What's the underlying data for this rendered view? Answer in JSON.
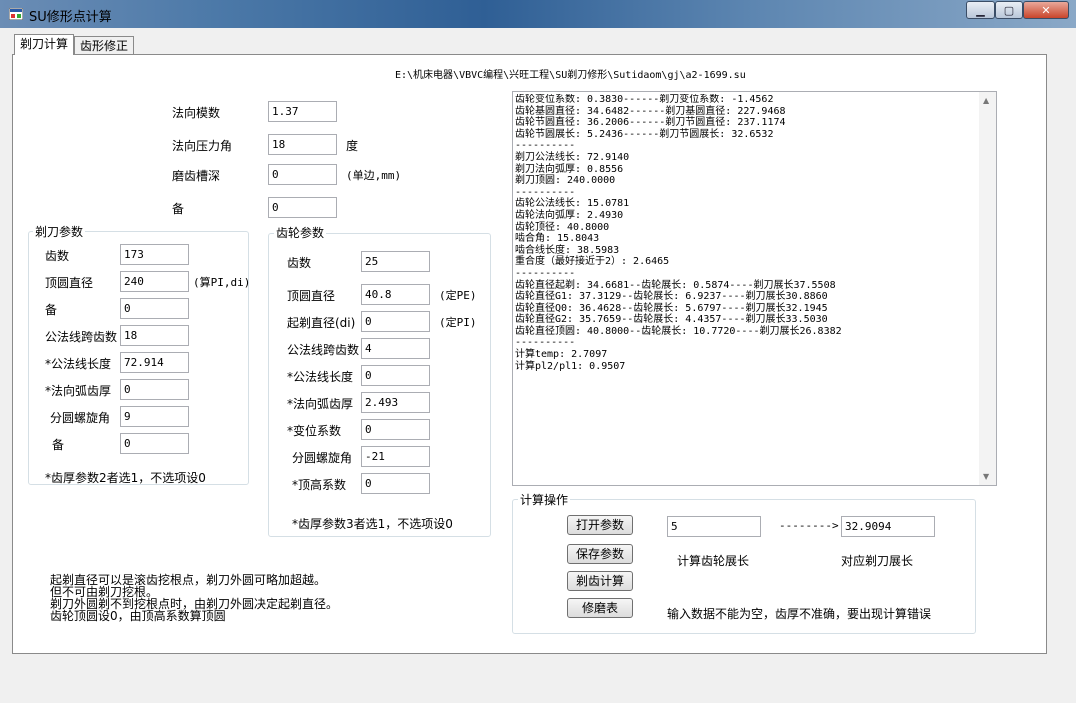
{
  "window": {
    "title": "SU修形点计算"
  },
  "tabs": [
    {
      "label": "剃刀计算"
    },
    {
      "label": "齿形修正"
    }
  ],
  "file_path": "E:\\机床电器\\VBVC编程\\兴旺工程\\SU剃刀修形\\Sutidaom\\gj\\a2-1699.su",
  "top_fields": [
    {
      "label": "法向模数",
      "value": "1.37",
      "unit": ""
    },
    {
      "label": "法向压力角",
      "value": "18",
      "unit": "度"
    },
    {
      "label": "磨齿槽深",
      "value": "0",
      "unit": "(单边,mm)"
    },
    {
      "label": "备",
      "value": "0",
      "unit": ""
    }
  ],
  "shaver_group": {
    "title": "剃刀参数",
    "fields": [
      {
        "label": "齿数",
        "value": "173",
        "unit": ""
      },
      {
        "label": "顶圆直径",
        "value": "240",
        "unit": "(算PI,di)"
      },
      {
        "label": "备",
        "value": "0",
        "unit": ""
      },
      {
        "label": "公法线跨齿数",
        "value": "18",
        "unit": ""
      },
      {
        "label": "*公法线长度",
        "value": "72.914",
        "unit": ""
      },
      {
        "label": "*法向弧齿厚",
        "value": "0",
        "unit": ""
      },
      {
        "label": "分圆螺旋角",
        "value": "9",
        "unit": ""
      },
      {
        "label": "备",
        "value": "0",
        "unit": ""
      }
    ],
    "note": "*齿厚参数2者选1，不选项设0"
  },
  "gear_group": {
    "title": "齿轮参数",
    "fields": [
      {
        "label": "齿数",
        "value": "25",
        "unit": ""
      },
      {
        "label": "顶圆直径",
        "value": "40.8",
        "unit": "(定PE)"
      },
      {
        "label": "起剃直径(di)",
        "value": "0",
        "unit": "(定PI)"
      },
      {
        "label": "公法线跨齿数",
        "value": "4",
        "unit": ""
      },
      {
        "label": "*公法线长度",
        "value": "0",
        "unit": ""
      },
      {
        "label": "*法向弧齿厚",
        "value": "2.493",
        "unit": ""
      },
      {
        "label": "*变位系数",
        "value": "0",
        "unit": ""
      },
      {
        "label": "分圆螺旋角",
        "value": "-21",
        "unit": ""
      },
      {
        "label": "*顶高系数",
        "value": "0",
        "unit": ""
      }
    ],
    "note": "*齿厚参数3者选1，不选项设0"
  },
  "output_lines": [
    "齿轮变位系数: 0.3830------剃刀变位系数: -1.4562",
    "齿轮基圆直径: 34.6482------剃刀基圆直径: 227.9468",
    "齿轮节圆直径: 36.2006------剃刀节圆直径: 237.1174",
    "齿轮节圆展长: 5.2436------剃刀节圆展长: 32.6532",
    "----------",
    "剃刀公法线长: 72.9140",
    "剃刀法向弧厚: 0.8556",
    "剃刀顶圆: 240.0000",
    "----------",
    "齿轮公法线长: 15.0781",
    "齿轮法向弧厚: 2.4930",
    "齿轮顶径: 40.8000",
    "啮合角: 15.8043",
    "啮合线长度: 38.5983",
    "重合度（最好接近于2）: 2.6465",
    "----------",
    "齿轮直径起剃: 34.6681--齿轮展长: 0.5874----剃刀展长37.5508",
    "齿轮直径G1: 37.3129--齿轮展长: 6.9237----剃刀展长30.8860",
    "齿轮直径Q0: 36.4628--齿轮展长: 5.6797----剃刀展长32.1945",
    "齿轮直径G2: 35.7659--齿轮展长: 4.4357----剃刀展长33.5030",
    "齿轮直径顶圆: 40.8000--齿轮展长: 10.7720----剃刀展长26.8382",
    "----------",
    "计算temp: 2.7097",
    "计算pl2/pl1: 0.9507"
  ],
  "calc_group": {
    "title": "计算操作",
    "buttons": [
      {
        "label": "打开参数"
      },
      {
        "label": "保存参数"
      },
      {
        "label": "剃齿计算"
      },
      {
        "label": "修磨表"
      }
    ],
    "input_value": "5",
    "arrow": "-------->",
    "result_value": "32.9094",
    "input_caption": "计算齿轮展长",
    "result_caption": "对应剃刀展长",
    "warning": "输入数据不能为空，齿厚不准确，要出现计算错误"
  },
  "notes": [
    "起剃直径可以是滚齿挖根点，剃刀外圆可略加超越。",
    "但不可由剃刀挖根。",
    "剃刀外圆剃不到挖根点时，由剃刀外圆决定起剃直径。",
    "齿轮顶圆设0，由顶高系数算顶圆"
  ]
}
